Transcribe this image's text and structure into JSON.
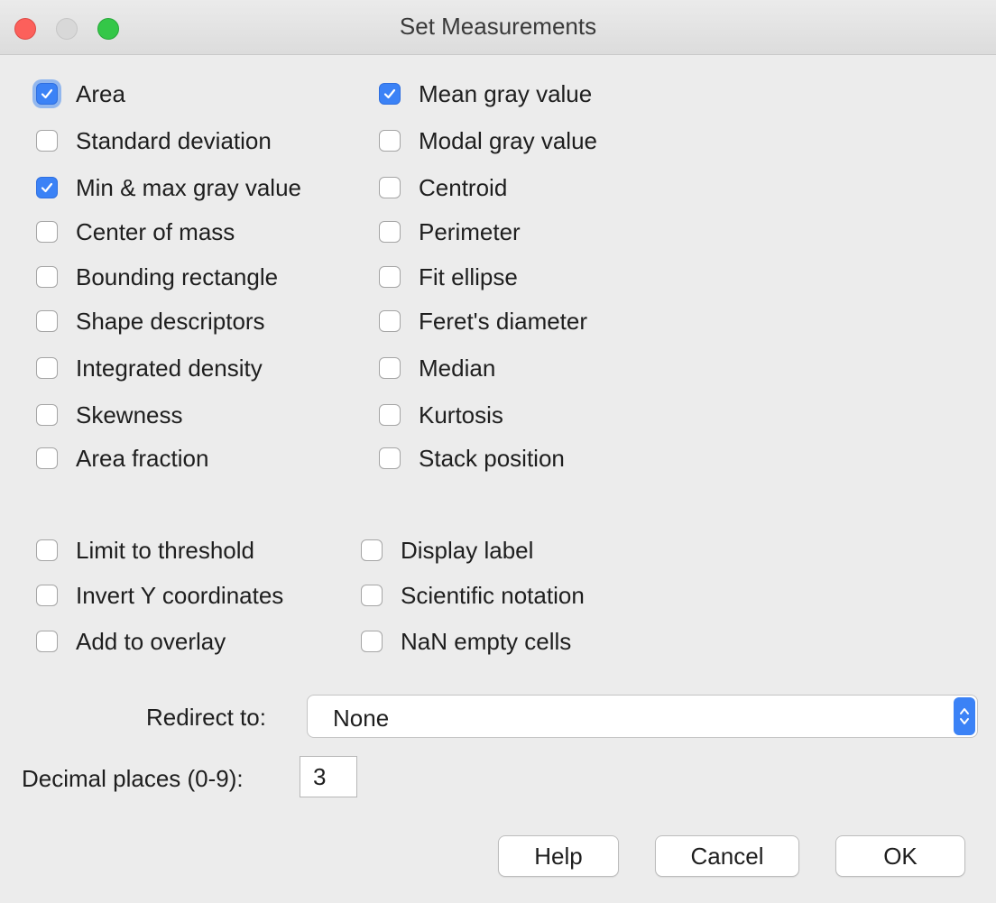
{
  "window": {
    "title": "Set Measurements"
  },
  "colors": {
    "accent": "#3b82f6",
    "close": "#fc605b",
    "minimize": "#d8d8d8",
    "zoom": "#34c748"
  },
  "measurements_left": [
    {
      "label": "Area",
      "checked": true
    },
    {
      "label": "Standard deviation",
      "checked": false
    },
    {
      "label": "Min & max gray value",
      "checked": true
    },
    {
      "label": "Center of mass",
      "checked": false
    },
    {
      "label": "Bounding rectangle",
      "checked": false
    },
    {
      "label": "Shape descriptors",
      "checked": false
    },
    {
      "label": "Integrated density",
      "checked": false
    },
    {
      "label": "Skewness",
      "checked": false
    },
    {
      "label": "Area fraction",
      "checked": false
    }
  ],
  "measurements_right": [
    {
      "label": "Mean gray value",
      "checked": true
    },
    {
      "label": "Modal gray value",
      "checked": false
    },
    {
      "label": "Centroid",
      "checked": false
    },
    {
      "label": "Perimeter",
      "checked": false
    },
    {
      "label": "Fit ellipse",
      "checked": false
    },
    {
      "label": "Feret's diameter",
      "checked": false
    },
    {
      "label": "Median",
      "checked": false
    },
    {
      "label": "Kurtosis",
      "checked": false
    },
    {
      "label": "Stack position",
      "checked": false
    }
  ],
  "options_left": [
    {
      "label": "Limit to threshold",
      "checked": false
    },
    {
      "label": "Invert Y coordinates",
      "checked": false
    },
    {
      "label": "Add to overlay",
      "checked": false
    }
  ],
  "options_right": [
    {
      "label": "Display label",
      "checked": false
    },
    {
      "label": "Scientific notation",
      "checked": false
    },
    {
      "label": "NaN empty cells",
      "checked": false
    }
  ],
  "redirect": {
    "label": "Redirect to:",
    "value": "None"
  },
  "decimal": {
    "label": "Decimal places (0-9):",
    "value": "3"
  },
  "buttons": {
    "help": "Help",
    "cancel": "Cancel",
    "ok": "OK"
  }
}
